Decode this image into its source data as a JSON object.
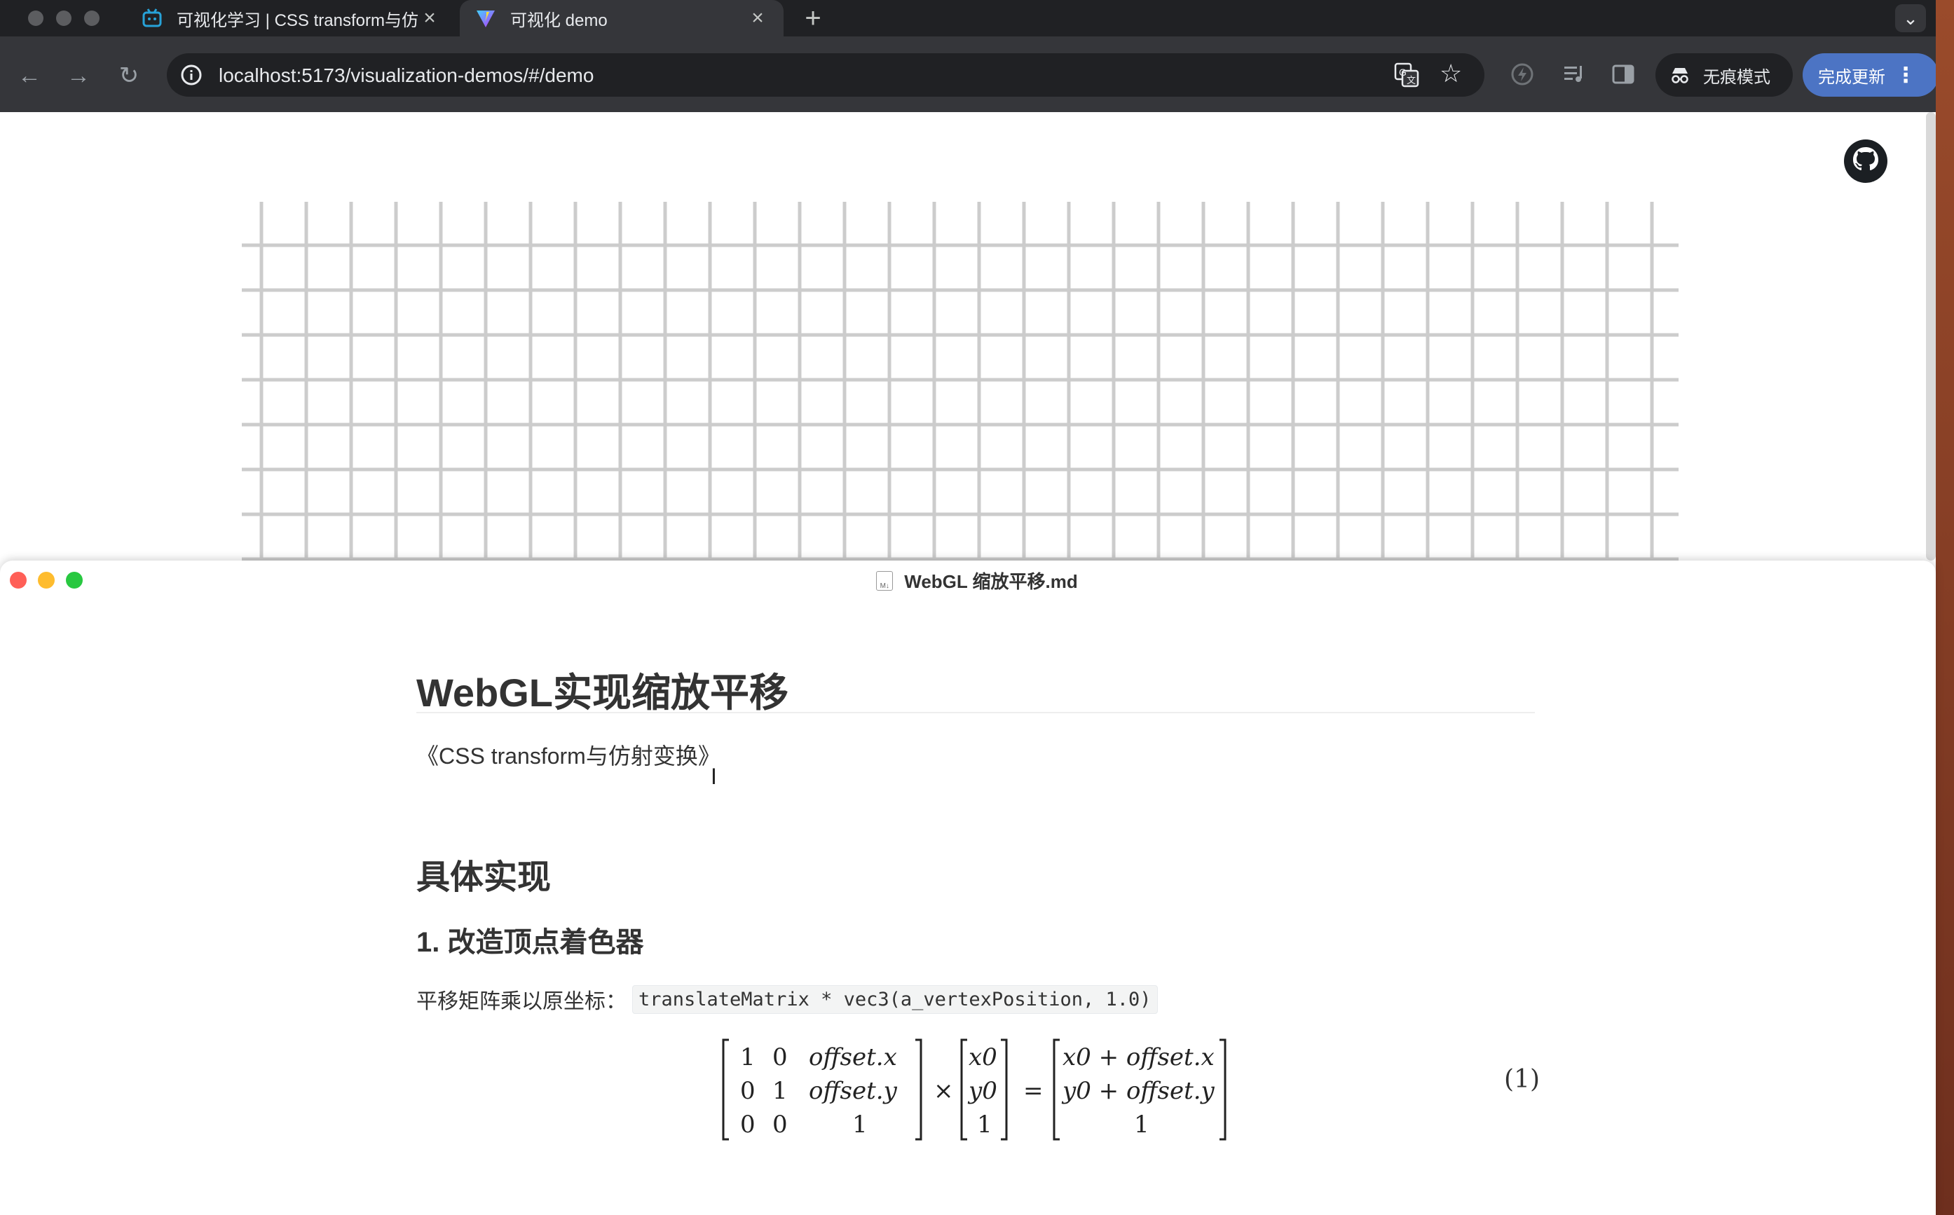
{
  "browser": {
    "tabs": [
      {
        "title": "可视化学习 | CSS transform与仿",
        "favicon": "bilibili-tv-icon",
        "active": false
      },
      {
        "title": "可视化 demo",
        "favicon": "vite-logo-icon",
        "active": true
      }
    ],
    "url": "localhost:5173/visualization-demos/#/demo",
    "incognito_label": "无痕模式",
    "update_label": "完成更新",
    "accent": "#4c74c4"
  },
  "page": {
    "github_icon": "github-icon",
    "grid": {
      "columns": 32,
      "rows": 8,
      "line_color": "#cccccc"
    }
  },
  "editor": {
    "window_title": "WebGL 缩放平移.md",
    "file_badge": "M↓",
    "heading1": "WebGL实现缩放平移",
    "intro": "《CSS transform与仿射变换》",
    "heading2": "具体实现",
    "heading3": "1. 改造顶点着色器",
    "paragraph_label": "平移矩阵乘以原坐标：",
    "code": "translateMatrix * vec3(a_vertexPosition, 1.0)",
    "equation": {
      "matrix_a": [
        [
          "1",
          "0",
          "offset.x"
        ],
        [
          "0",
          "1",
          "offset.y"
        ],
        [
          "0",
          "0",
          "1"
        ]
      ],
      "vector_b": [
        "x0",
        "y0",
        "1"
      ],
      "result": [
        "x0 + offset.x",
        "y0 + offset.y",
        "1"
      ],
      "times": "×",
      "equals": "=",
      "number": "(1)"
    }
  }
}
